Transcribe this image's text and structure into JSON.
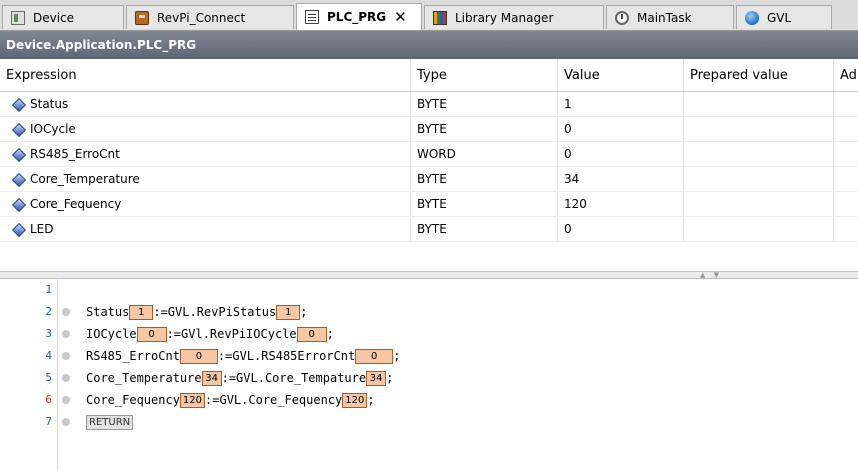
{
  "tabs": [
    {
      "label": "Device",
      "icon": "device-icon",
      "active": false
    },
    {
      "label": "RevPi_Connect",
      "icon": "revpi-connect-icon",
      "active": false
    },
    {
      "label": "PLC_PRG",
      "icon": "plc-program-icon",
      "active": true,
      "close": "✕"
    },
    {
      "label": "Library Manager",
      "icon": "library-manager-icon",
      "active": false
    },
    {
      "label": "MainTask",
      "icon": "task-icon",
      "active": false
    },
    {
      "label": "GVL",
      "icon": "gvl-globe-icon",
      "active": false
    }
  ],
  "path": "Device.Application.PLC_PRG",
  "watch": {
    "headers": {
      "expression": "Expression",
      "type": "Type",
      "value": "Value",
      "prepared": "Prepared value",
      "address": "Ad"
    },
    "rows": [
      {
        "name": "Status",
        "type": "BYTE",
        "value": "1"
      },
      {
        "name": "IOCycle",
        "type": "BYTE",
        "value": "0"
      },
      {
        "name": "RS485_ErroCnt",
        "type": "WORD",
        "value": "0"
      },
      {
        "name": "Core_Temperature",
        "type": "BYTE",
        "value": "34"
      },
      {
        "name": "Core_Fequency",
        "type": "BYTE",
        "value": "120"
      },
      {
        "name": "LED",
        "type": "BYTE",
        "value": "0"
      }
    ]
  },
  "editor": {
    "lines": [
      {
        "num": "1"
      },
      {
        "num": "2",
        "lhs": "Status",
        "lv": "1",
        "rhs": ":=GVL.RevPiStatus",
        "rv": "1"
      },
      {
        "num": "3",
        "lhs": "IOCycle",
        "lv": "0",
        "rhs": ":=GVl.RevPiIOCycle",
        "rv": "0"
      },
      {
        "num": "4",
        "lhs": "RS485_ErroCnt",
        "lv": "0",
        "rhs": ":=GVL.RS485ErrorCnt",
        "rv": "0"
      },
      {
        "num": "5",
        "lhs": "Core_Temperature",
        "lv": "34",
        "rhs": ":=GVL.Core_Tempature",
        "rv": "34"
      },
      {
        "num": "6",
        "lhs": "Core_Fequency",
        "lv": "120",
        "rhs": ":=GVL.Core_Fequency",
        "rv": "120"
      },
      {
        "num": "7",
        "keyword": "RETURN"
      }
    ],
    "terminator": ";"
  }
}
